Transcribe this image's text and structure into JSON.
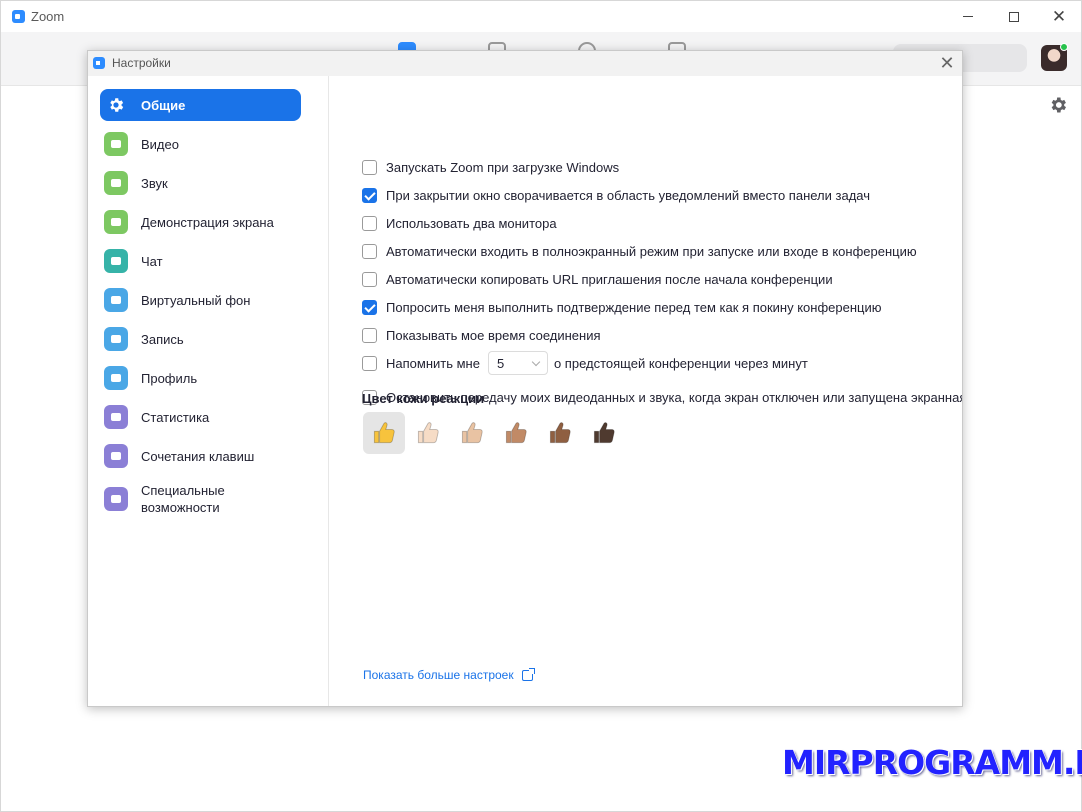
{
  "app": {
    "title": "Zoom"
  },
  "dialog": {
    "title": "Настройки"
  },
  "colors": {
    "accent": "#1a73e8",
    "brand": "#2d8cff"
  },
  "sidebar": {
    "items": [
      {
        "label": "Общие",
        "icon": "gear-icon",
        "color": "#ffffff",
        "active": true
      },
      {
        "label": "Видео",
        "icon": "video-icon",
        "color": "#7dc862"
      },
      {
        "label": "Звук",
        "icon": "headphones-icon",
        "color": "#7dc862"
      },
      {
        "label": "Демонстрация экрана",
        "icon": "share-screen-icon",
        "color": "#7dc862"
      },
      {
        "label": "Чат",
        "icon": "chat-icon",
        "color": "#36b3a8"
      },
      {
        "label": "Виртуальный фон",
        "icon": "virtual-background-icon",
        "color": "#4aa7e6"
      },
      {
        "label": "Запись",
        "icon": "record-icon",
        "color": "#4aa7e6"
      },
      {
        "label": "Профиль",
        "icon": "profile-icon",
        "color": "#4aa7e6"
      },
      {
        "label": "Статистика",
        "icon": "statistics-icon",
        "color": "#8b7fd6"
      },
      {
        "label": "Сочетания клавиш",
        "icon": "keyboard-icon",
        "color": "#8b7fd6"
      },
      {
        "label": "Специальные возможности",
        "icon": "accessibility-icon",
        "color": "#8b7fd6"
      }
    ]
  },
  "options": [
    {
      "label": "Запускать Zoom при загрузке Windows",
      "checked": false
    },
    {
      "label": "При закрытии окно сворачивается в область уведомлений вместо панели задач",
      "checked": true
    },
    {
      "label": "Использовать два монитора",
      "checked": false
    },
    {
      "label": "Автоматически входить в полноэкранный режим при запуске или входе в конференцию",
      "checked": false
    },
    {
      "label": "Автоматически копировать URL приглашения после начала конференции",
      "checked": false
    },
    {
      "label": "Попросить меня выполнить подтверждение перед тем как я покину конференцию",
      "checked": true
    },
    {
      "label": "Показывать мое время соединения",
      "checked": false
    }
  ],
  "reminder": {
    "label_before": "Напомнить мне",
    "value": "5",
    "label_after": "о предстоящей конференции через минут",
    "checked": false
  },
  "stop_video": {
    "label": "Остановить передачу моих видеоданных и звука, когда экран отключен или запущена экранная",
    "checked": false
  },
  "skin_tone": {
    "title": "Цвет кожи реакции",
    "tones": [
      "#f7c33d",
      "#f6dcc6",
      "#e9c3a3",
      "#c18a66",
      "#8f5f41",
      "#4f3a2f"
    ],
    "selected": 0
  },
  "more_link": {
    "label": "Показать больше настроек"
  },
  "watermark": "MIRPROGRAMM.RU"
}
